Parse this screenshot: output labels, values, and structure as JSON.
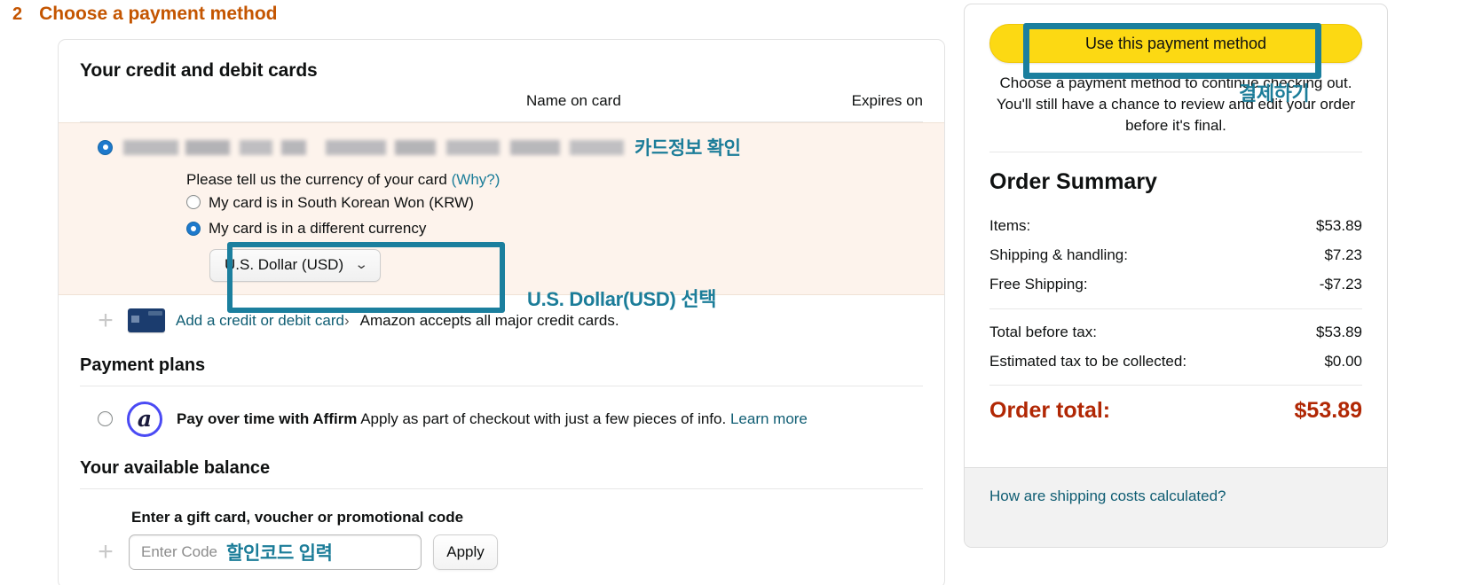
{
  "step": {
    "number": "2",
    "title": "Choose a payment method"
  },
  "cards_section": {
    "title": "Your credit and debit cards",
    "columns": {
      "name_on_card": "Name on card",
      "expires_on": "Expires on"
    },
    "selected_card": {
      "masked_details": "",
      "annotation_kr": "카드정보 확인"
    },
    "currency": {
      "prompt": "Please tell us the currency of your card",
      "why_link": "(Why?)",
      "option_local": "My card is in South Korean Won (KRW)",
      "option_other": "My card is in a different currency",
      "selected_currency": "U.S. Dollar (USD)",
      "chevron_icon": "⌄",
      "annotation_kr": "U.S. Dollar(USD) 선택"
    },
    "add_card": {
      "plus_icon": "+",
      "link": "Add a credit or debit card",
      "arrow": "›",
      "note": "Amazon accepts all major credit cards."
    }
  },
  "payment_plans": {
    "title": "Payment plans",
    "affirm": {
      "logo_letter": "a",
      "headline": "Pay over time with Affirm",
      "description": "Apply as part of checkout with just a few pieces of info.",
      "learn_more": "Learn more"
    }
  },
  "available_balance": {
    "title": "Your available balance",
    "gift_label": "Enter a gift card, voucher or promotional code",
    "plus_icon": "+",
    "input_placeholder": "Enter Code",
    "input_annotation_kr": "할인코드 입력",
    "apply_label": "Apply"
  },
  "sidebar": {
    "use_button_label": "Use this payment method",
    "use_button_annotation_kr": "결제하기",
    "description": "Choose a payment method to continue checking out. You'll still have a chance to review and edit your order before it's final.",
    "order_summary": {
      "title": "Order Summary",
      "rows_primary": [
        {
          "label": "Items:",
          "value": "$53.89"
        },
        {
          "label": "Shipping & handling:",
          "value": "$7.23"
        },
        {
          "label": "Free Shipping:",
          "value": "-$7.23"
        }
      ],
      "rows_secondary": [
        {
          "label": "Total before tax:",
          "value": "$53.89"
        },
        {
          "label": "Estimated tax to be collected:",
          "value": "$0.00"
        }
      ],
      "total_label": "Order total:",
      "total_value": "$53.89"
    },
    "footer_link": "How are shipping costs calculated?"
  },
  "colors": {
    "amazon_orange": "#c45500",
    "annotation_teal": "#1c7d99",
    "highlight_box": "#1b7f9e",
    "link_teal": "#0f5d73",
    "price_red": "#b12704",
    "button_yellow": "#fcd913",
    "card_row_bg": "#fdf3ec",
    "radio_blue": "#1d79cc",
    "affirm_purple": "#4a4af4"
  }
}
